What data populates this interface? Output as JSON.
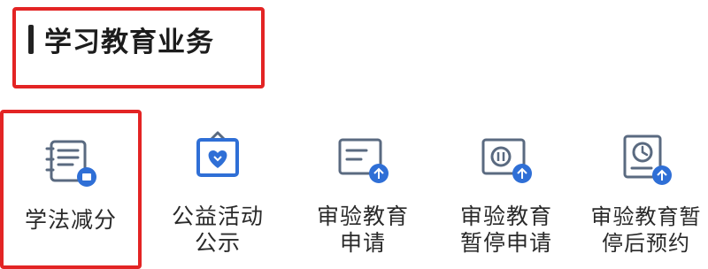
{
  "section": {
    "title": "学习教育业务"
  },
  "services": [
    {
      "label": "学法减分",
      "label2": "",
      "icon": "study-book-icon"
    },
    {
      "label": "公益活动",
      "label2": "公示",
      "icon": "charity-heart-board-icon"
    },
    {
      "label": "审验教育",
      "label2": "申请",
      "icon": "review-education-apply-icon"
    },
    {
      "label": "审验教育",
      "label2": "暂停申请",
      "icon": "review-education-pause-icon"
    },
    {
      "label": "审验教育暂",
      "label2": "停后预约",
      "icon": "review-education-appointment-icon"
    }
  ],
  "colors": {
    "highlight_border": "#e32424",
    "icon_blue": "#2f6fd6",
    "icon_gray": "#5a6a80"
  }
}
